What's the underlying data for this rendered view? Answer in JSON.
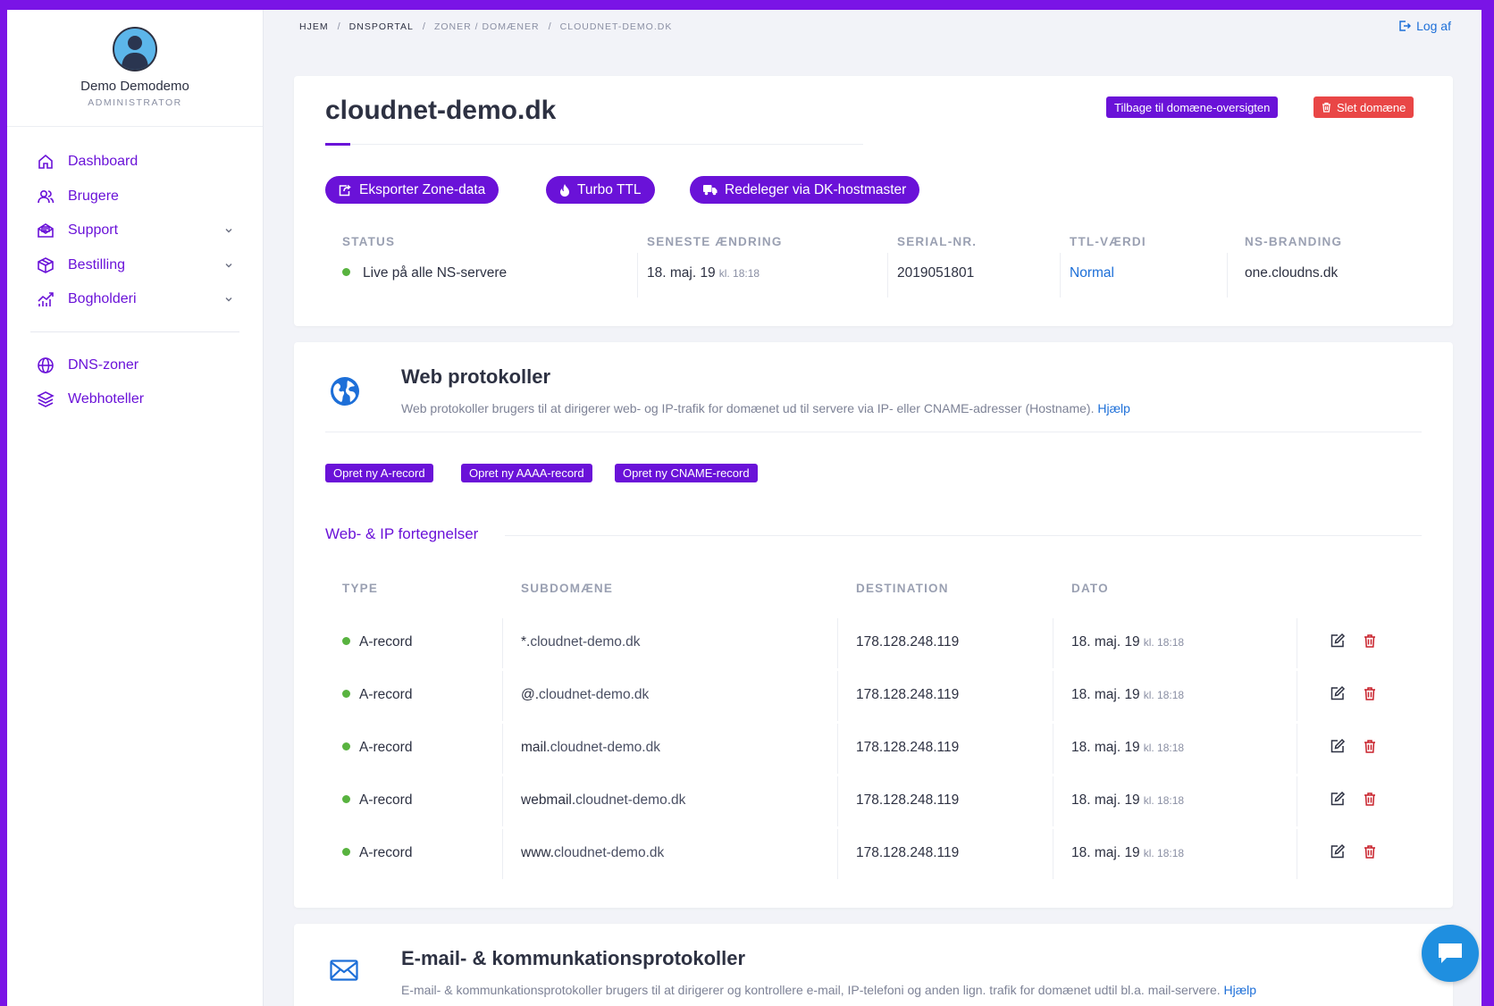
{
  "profile": {
    "name": "Demo Demodemo",
    "role": "ADMINISTRATOR"
  },
  "sidebar": {
    "items": [
      {
        "label": "Dashboard",
        "icon": "home-icon"
      },
      {
        "label": "Brugere",
        "icon": "users-icon"
      },
      {
        "label": "Support",
        "icon": "support-icon",
        "expandable": true
      },
      {
        "label": "Bestilling",
        "icon": "box-icon",
        "expandable": true
      },
      {
        "label": "Bogholderi",
        "icon": "chart-icon",
        "expandable": true
      },
      {
        "label": "DNS-zoner",
        "icon": "globe-icon"
      },
      {
        "label": "Webhoteller",
        "icon": "layers-icon"
      }
    ]
  },
  "breadcrumb": [
    "HJEM",
    "DNSPORTAL",
    "ZONER / DOMÆNER",
    "CLOUDNET-DEMO.DK"
  ],
  "logout_label": "Log af",
  "domain": {
    "title": "cloudnet-demo.dk",
    "back_label": "Tilbage til domæne-oversigten",
    "delete_label": "Slet domæne",
    "actions": {
      "export": "Eksporter Zone-data",
      "turbo": "Turbo TTL",
      "redelegate": "Redeleger via DK-hostmaster"
    },
    "info": {
      "headers": [
        "STATUS",
        "SENESTE ÆNDRING",
        "SERIAL-NR.",
        "TTL-VÆRDI",
        "NS-BRANDING"
      ],
      "status": "Live på alle NS-servere",
      "last_change_date": "18. maj. 19",
      "last_change_time": "kl. 18:18",
      "serial": "2019051801",
      "ttl": "Normal",
      "ns_branding": "one.cloudns.dk"
    }
  },
  "web": {
    "title": "Web protokoller",
    "description": "Web protokoller brugers til at dirigerer web- og IP-trafik for domænet ud til servere via IP- eller CNAME-adresser (Hostname).",
    "help": "Hjælp",
    "buttons": {
      "a": "Opret ny A-record",
      "aaaa": "Opret ny AAAA-record",
      "cname": "Opret ny CNAME-record"
    },
    "list_title": "Web- & IP fortegnelser",
    "headers": [
      "TYPE",
      "SUBDOMÆNE",
      "DESTINATION",
      "DATO"
    ],
    "rows": [
      {
        "type": "A-record",
        "prefix": "*.",
        "domain": "cloudnet-demo.dk",
        "destination": "178.128.248.119",
        "date": "18. maj. 19",
        "time": "kl. 18:18"
      },
      {
        "type": "A-record",
        "prefix": "@.",
        "domain": "cloudnet-demo.dk",
        "destination": "178.128.248.119",
        "date": "18. maj. 19",
        "time": "kl. 18:18"
      },
      {
        "type": "A-record",
        "prefix": "mail.",
        "domain": "cloudnet-demo.dk",
        "destination": "178.128.248.119",
        "date": "18. maj. 19",
        "time": "kl. 18:18"
      },
      {
        "type": "A-record",
        "prefix": "webmail.",
        "domain": "cloudnet-demo.dk",
        "destination": "178.128.248.119",
        "date": "18. maj. 19",
        "time": "kl. 18:18"
      },
      {
        "type": "A-record",
        "prefix": "www.",
        "domain": "cloudnet-demo.dk",
        "destination": "178.128.248.119",
        "date": "18. maj. 19",
        "time": "kl. 18:18"
      }
    ]
  },
  "email": {
    "title": "E-mail- & kommunkationsprotokoller",
    "description": "E-mail- & kommunkationsprotokoller brugers til at dirigerer og kontrollere e-mail, IP-telefoni og anden lign. trafik for domænet udtil bl.a. mail-servere.",
    "help": "Hjælp"
  },
  "colors": {
    "accent": "#6a12d8",
    "danger": "#e94646",
    "success": "#58b33f",
    "link": "#1d6fd8",
    "frame": "#7a14e6"
  }
}
